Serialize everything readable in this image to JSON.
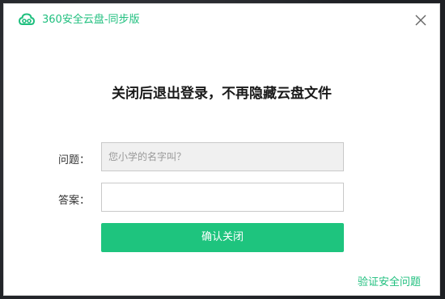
{
  "window": {
    "title": "360安全云盘-同步版",
    "close_icon": "close-icon",
    "logo_icon": "cloud-logo-icon",
    "accent_color": "#1ec47e"
  },
  "dialog": {
    "heading": "关闭后退出登录，不再隐藏云盘文件",
    "question_label": "问题：",
    "question_value": "您小学的名字叫？",
    "answer_label": "答案：",
    "answer_value": "",
    "confirm_button": "确认关闭",
    "verify_link": "验证安全问题"
  }
}
